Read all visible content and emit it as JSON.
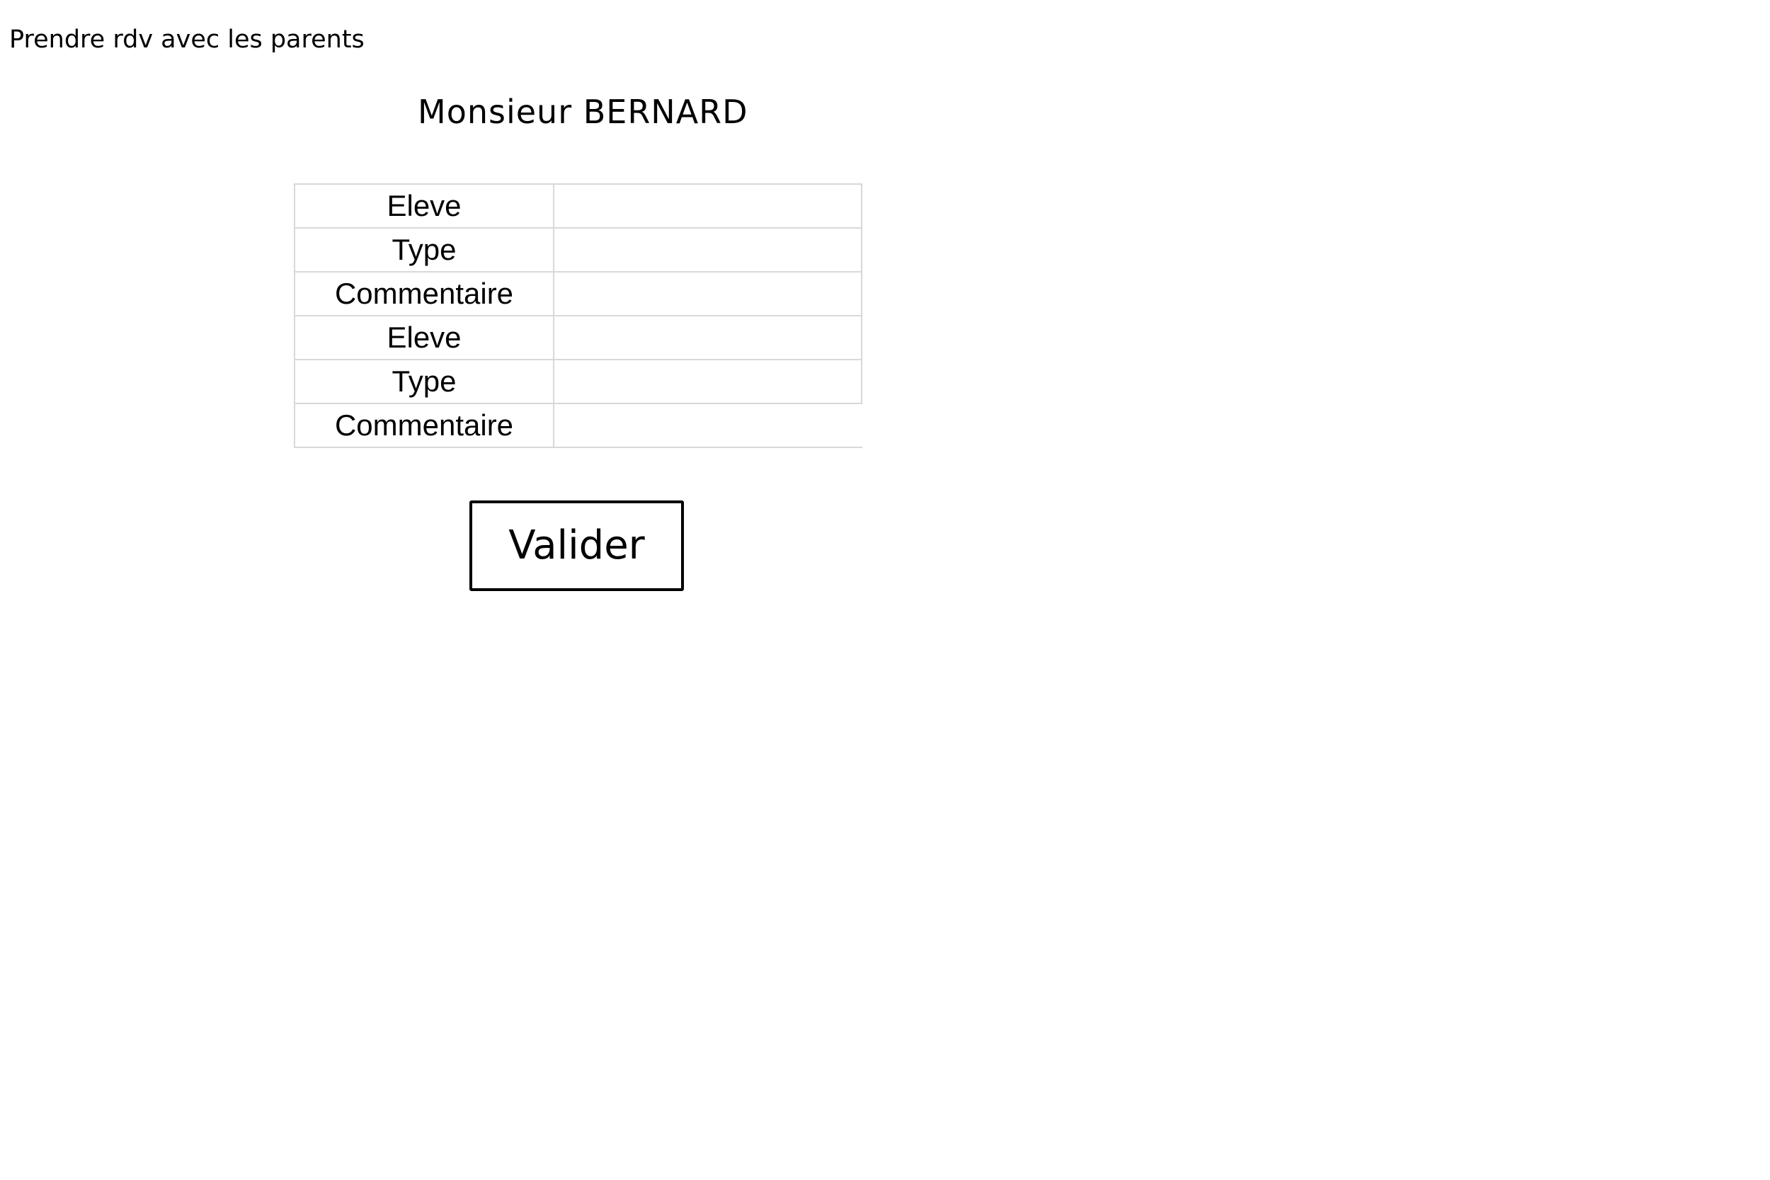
{
  "page": {
    "heading": "Prendre rdv avec les parents",
    "teacher_name": "Monsieur BERNARD"
  },
  "form": {
    "rows": [
      {
        "label": "Eleve",
        "value": ""
      },
      {
        "label": "Type",
        "value": ""
      },
      {
        "label": "Commentaire",
        "value": ""
      },
      {
        "label": "Eleve",
        "value": ""
      },
      {
        "label": "Type",
        "value": ""
      },
      {
        "label": "Commentaire",
        "value": ""
      }
    ],
    "submit_label": "Valider"
  }
}
